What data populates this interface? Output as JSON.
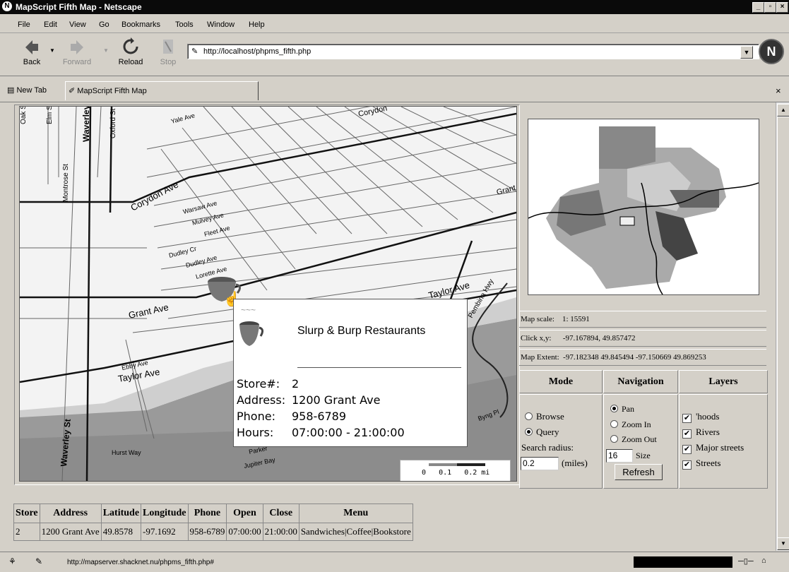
{
  "window": {
    "title": "MapScript Fifth Map - Netscape"
  },
  "menu": [
    "File",
    "Edit",
    "View",
    "Go",
    "Bookmarks",
    "Tools",
    "Window",
    "Help"
  ],
  "toolbar": {
    "back": "Back",
    "forward": "Forward",
    "reload": "Reload",
    "stop": "Stop",
    "url": "http://localhost/phpms_fifth.php"
  },
  "tabs": {
    "new_tab": "New Tab",
    "active": "MapScript Fifth Map"
  },
  "map": {
    "streets": [
      "Oak St",
      "Elm St",
      "Waverley St",
      "Oxford St",
      "Yale Ave",
      "Corydon Ave",
      "Montrose St",
      "Warsaw Ave",
      "Mulvey Ave",
      "Fleet Ave",
      "Dudley Cr",
      "Dudley Ave",
      "Lorette Ave",
      "Grant Ave",
      "Taylor Ave",
      "Pembina Hwy",
      "Ebby Ave",
      "Taylor Ave",
      "Waverley St",
      "Hurst Way",
      "Parker",
      "Jupiter Bay",
      "Byng Pl",
      "Corydon"
    ],
    "scalebar": "0   0.1   0.2 mi"
  },
  "popup": {
    "title": "Slurp & Burp Restaurants",
    "fields": [
      {
        "k": "Store#:",
        "v": "2"
      },
      {
        "k": "Address:",
        "v": "1200 Grant Ave"
      },
      {
        "k": "Phone:",
        "v": "958-6789"
      },
      {
        "k": "Hours:",
        "v": "07:00:00 - 21:00:00"
      }
    ]
  },
  "info": {
    "scale": "Map scale:    1: 15591",
    "click": "Click x,y:      -97.167894, 49.857472",
    "extent": "Map Extent:  -97.182348 49.845494 -97.150669 49.869253"
  },
  "controls": {
    "mode_header": "Mode",
    "nav_header": "Navigation",
    "layers_header": "Layers",
    "mode": {
      "browse": "Browse",
      "query": "Query",
      "radius_label": "Search radius:",
      "radius_value": "0.2",
      "radius_unit": "(miles)"
    },
    "nav": {
      "pan": "Pan",
      "zoom_in": "Zoom In",
      "zoom_out": "Zoom Out",
      "size_value": "16",
      "size_label": "Size",
      "refresh": "Refresh"
    },
    "layers": [
      "'hoods",
      "Rivers",
      "Major streets",
      "Streets"
    ]
  },
  "table": {
    "headers": [
      "Store",
      "Address",
      "Latitude",
      "Longitude",
      "Phone",
      "Open",
      "Close",
      "Menu"
    ],
    "rows": [
      [
        "2",
        "1200 Grant Ave",
        "49.8578",
        "-97.1692",
        "958-6789",
        "07:00:00",
        "21:00:00",
        "Sandwiches|Coffee|Bookstore"
      ]
    ]
  },
  "status": {
    "text": "http://mapserver.shacknet.nu/phpms_fifth.php#"
  }
}
